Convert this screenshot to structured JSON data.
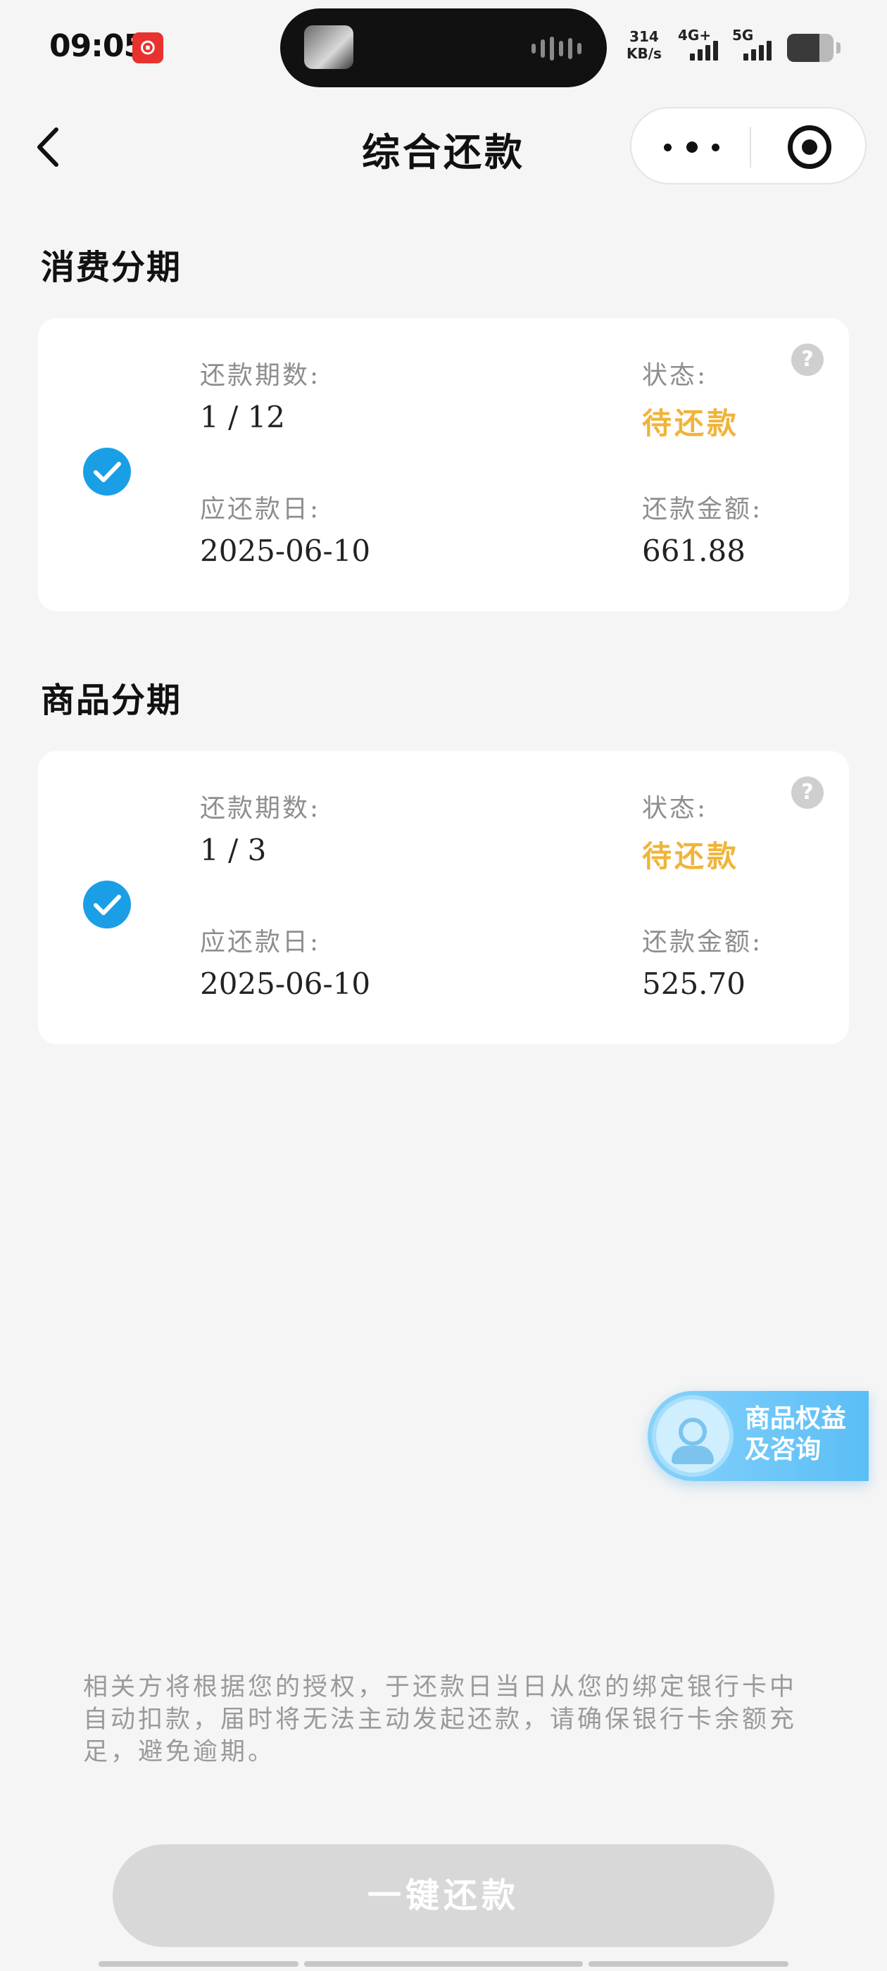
{
  "status_bar": {
    "time": "09:05",
    "notif_app_icon": "netease-music-icon",
    "net_speed_value": "314",
    "net_speed_unit": "KB/s",
    "signal1_label": "4G+",
    "signal2_label": "5G",
    "battery_level": 0.7
  },
  "nav": {
    "title": "综合还款",
    "back_icon": "chevron-left-icon",
    "more_icon": "more-dots-icon",
    "close_icon": "target-close-icon"
  },
  "sections": [
    {
      "title": "消费分期",
      "card": {
        "selected": true,
        "period_label": "还款期数:",
        "period_value": "1 / 12",
        "status_label": "状态:",
        "status_value": "待还款",
        "due_label": "应还款日:",
        "due_value": "2025-06-10",
        "amount_label": "还款金额:",
        "amount_value": "661.88"
      }
    },
    {
      "title": "商品分期",
      "card": {
        "selected": true,
        "period_label": "还款期数:",
        "period_value": "1 / 3",
        "status_label": "状态:",
        "status_value": "待还款",
        "due_label": "应还款日:",
        "due_value": "2025-06-10",
        "amount_label": "还款金额:",
        "amount_value": "525.70"
      }
    }
  ],
  "help_icon_glyph": "?",
  "consult": {
    "line1": "商品权益",
    "line2": "及咨询"
  },
  "notice": "相关方将根据您的授权，于还款日当日从您的绑定银行卡中自动扣款，届时将无法主动发起还款，请确保银行卡余额充足，避免逾期。",
  "pay_button": "一键还款",
  "colors": {
    "accent_blue": "#1a9fe6",
    "status_orange": "#f0b43a",
    "disabled_button": "#d8d8d8",
    "background": "#f5f5f5"
  }
}
